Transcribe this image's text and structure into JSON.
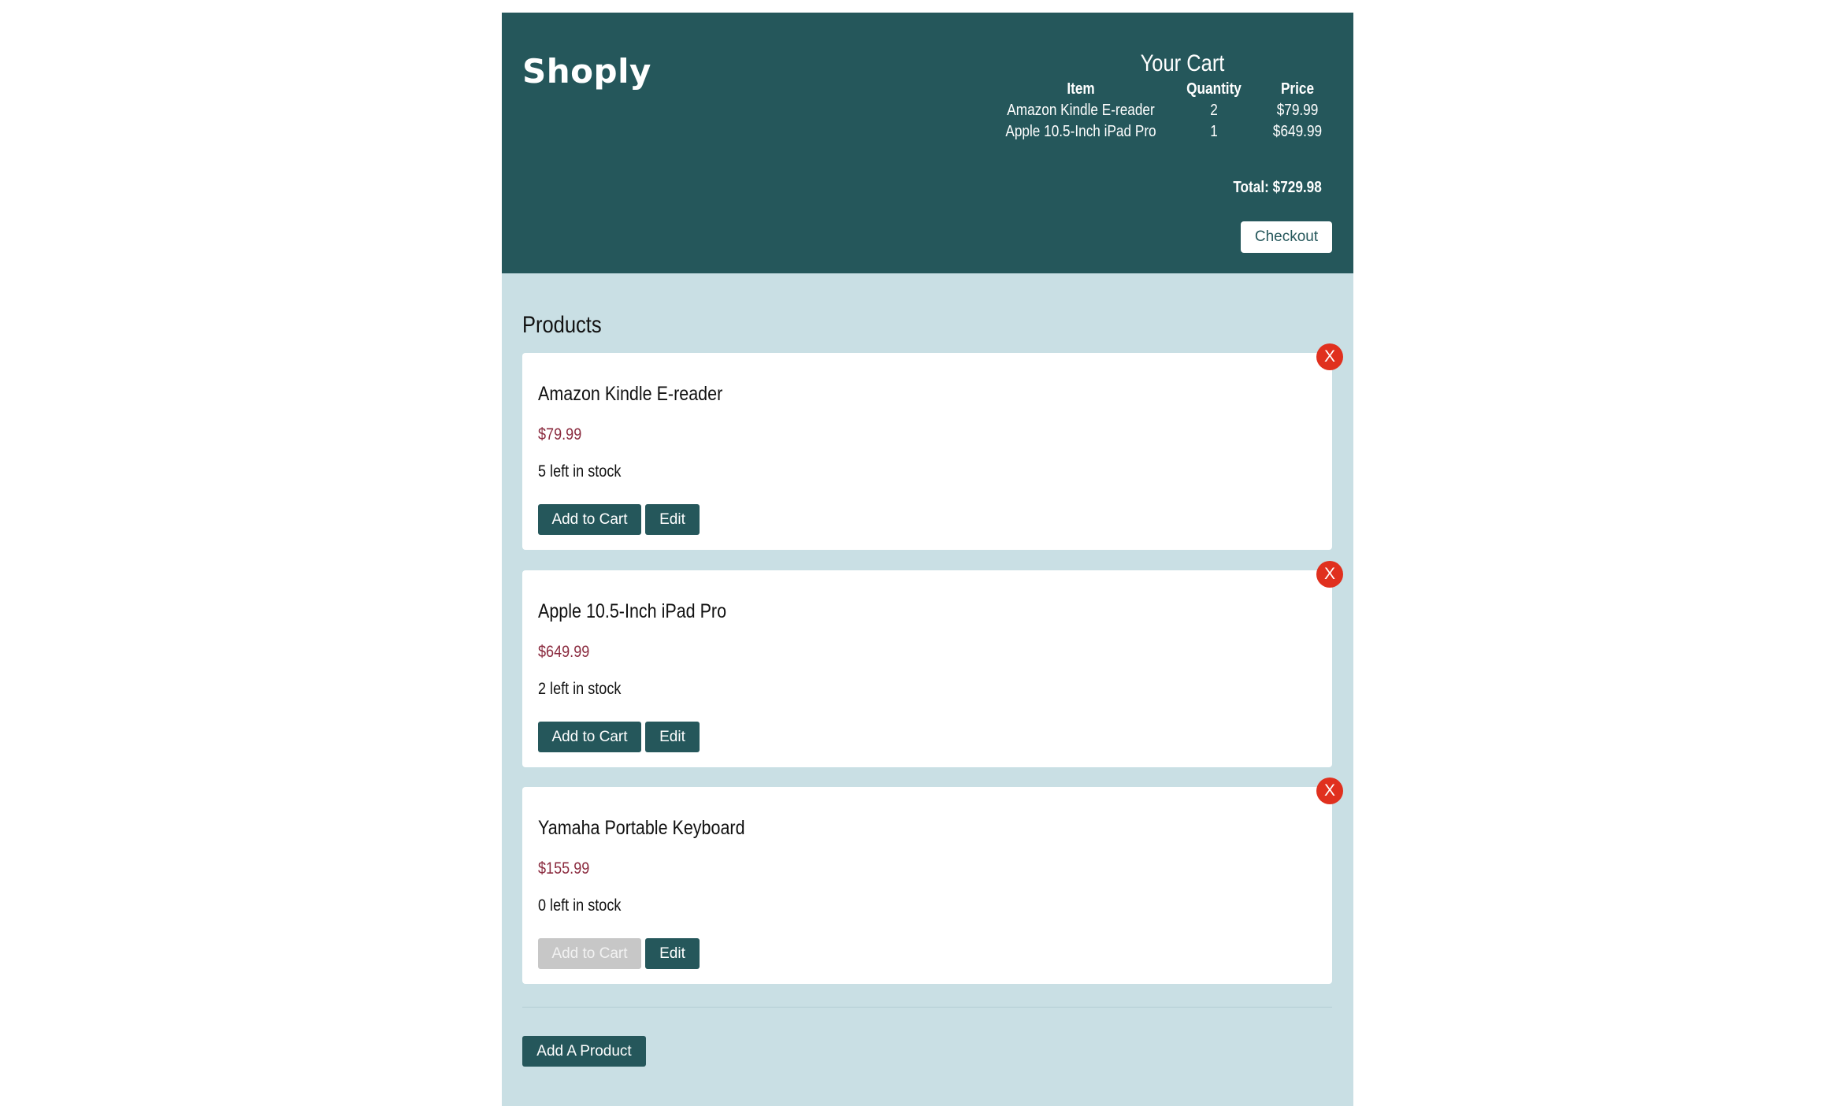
{
  "header": {
    "logo": "Shoply",
    "cart": {
      "title": "Your Cart",
      "columns": {
        "item": "Item",
        "quantity": "Quantity",
        "price": "Price"
      },
      "rows": [
        {
          "item": "Amazon Kindle E-reader",
          "quantity": "2",
          "price": "$79.99"
        },
        {
          "item": "Apple 10.5-Inch iPad Pro",
          "quantity": "1",
          "price": "$649.99"
        }
      ],
      "total": "Total: $729.98",
      "checkout_label": "Checkout"
    }
  },
  "products": {
    "heading": "Products",
    "items": [
      {
        "name": "Amazon Kindle E-reader",
        "price": "$79.99",
        "stock": "5 left in stock",
        "add_label": "Add to Cart",
        "edit_label": "Edit",
        "delete_label": "X",
        "add_disabled": false
      },
      {
        "name": "Apple 10.5-Inch iPad Pro",
        "price": "$649.99",
        "stock": "2 left in stock",
        "add_label": "Add to Cart",
        "edit_label": "Edit",
        "delete_label": "X",
        "add_disabled": false
      },
      {
        "name": "Yamaha Portable Keyboard",
        "price": "$155.99",
        "stock": "0 left in stock",
        "add_label": "Add to Cart",
        "edit_label": "Edit",
        "delete_label": "X",
        "add_disabled": true
      }
    ],
    "add_product_label": "Add A Product"
  },
  "colors": {
    "header_bg": "#25575b",
    "page_bg": "#c9dfe4",
    "price_text": "#8a2a3e",
    "delete_red": "#e0301e",
    "disabled_button": "#c7c7c7"
  }
}
